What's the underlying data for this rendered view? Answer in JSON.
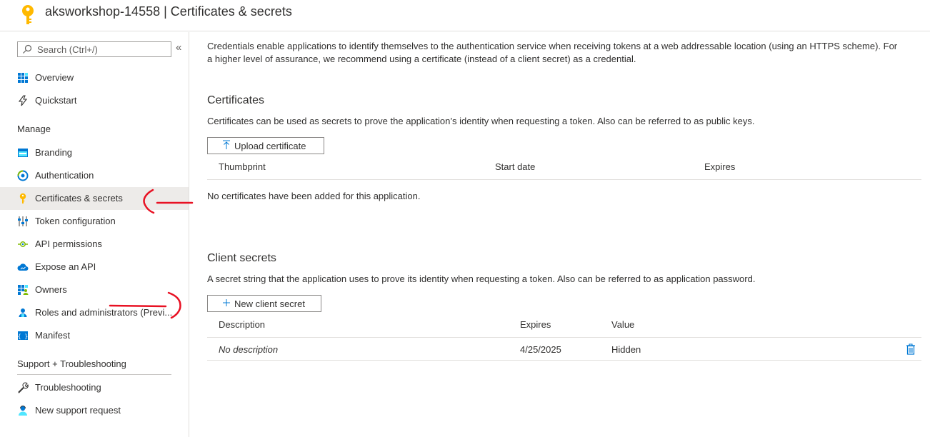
{
  "header": {
    "title": "aksworkshop-14558 | Certificates & secrets",
    "icon": "key-icon"
  },
  "sidebar": {
    "search_placeholder": "Search (Ctrl+/)",
    "collapse": "«",
    "top_items": [
      {
        "label": "Overview",
        "icon": "overview-grid-icon"
      },
      {
        "label": "Quickstart",
        "icon": "lightning-icon"
      }
    ],
    "manage_header": "Manage",
    "manage_items": [
      {
        "label": "Branding",
        "icon": "branding-icon"
      },
      {
        "label": "Authentication",
        "icon": "authentication-icon"
      },
      {
        "label": "Certificates & secrets",
        "icon": "key-icon",
        "selected": true
      },
      {
        "label": "Token configuration",
        "icon": "token-config-icon"
      },
      {
        "label": "API permissions",
        "icon": "api-permissions-icon"
      },
      {
        "label": "Expose an API",
        "icon": "cloud-icon"
      },
      {
        "label": "Owners",
        "icon": "owners-icon"
      },
      {
        "label": "Roles and administrators (Previ...",
        "icon": "roles-icon"
      },
      {
        "label": "Manifest",
        "icon": "manifest-icon"
      }
    ],
    "support_header": "Support + Troubleshooting",
    "support_items": [
      {
        "label": "Troubleshooting",
        "icon": "wrench-icon"
      },
      {
        "label": "New support request",
        "icon": "support-person-icon"
      }
    ]
  },
  "main": {
    "intro": "Credentials enable applications to identify themselves to the authentication service when receiving tokens at a web addressable location (using an HTTPS scheme). For a higher level of assurance, we recommend using a certificate (instead of a client secret) as a credential.",
    "certificates": {
      "title": "Certificates",
      "description": "Certificates can be used as secrets to prove the application’s identity when requesting a token. Also can be referred to as public keys.",
      "upload_button": "Upload certificate",
      "columns": [
        "Thumbprint",
        "Start date",
        "Expires"
      ],
      "empty_message": "No certificates have been added for this application."
    },
    "client_secrets": {
      "title": "Client secrets",
      "description": "A secret string that the application uses to prove its identity when requesting a token. Also can be referred to as application password.",
      "new_button": "New client secret",
      "columns": [
        "Description",
        "Expires",
        "Value"
      ],
      "rows": [
        {
          "description": "No description",
          "expires": "4/25/2025",
          "value": "Hidden"
        }
      ]
    }
  },
  "colors": {
    "accent": "#0078d4",
    "key_yellow": "#ffb900",
    "annotation_red": "#e81123",
    "selected_bg": "#edebe9"
  }
}
